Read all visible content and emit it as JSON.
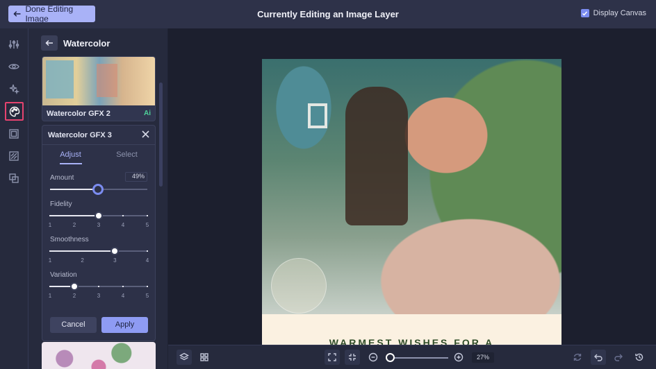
{
  "topbar": {
    "done_label": "Done Editing Image",
    "title": "Currently Editing an Image Layer",
    "display_canvas_label": "Display Canvas",
    "display_canvas_checked": true
  },
  "rail": {
    "icons": [
      "adjust-sliders-icon",
      "eye-icon",
      "sparkle-icon",
      "palette-icon",
      "frame-icon",
      "mask-icon",
      "layers-overlap-icon"
    ],
    "active": "palette-icon"
  },
  "panel": {
    "title": "Watercolor",
    "preset_top": {
      "name": "Watercolor GFX 2",
      "badge": "Ai"
    },
    "adjust": {
      "name": "Watercolor GFX 3",
      "tabs": [
        "Adjust",
        "Select"
      ],
      "active_tab": "Adjust",
      "amount": {
        "label": "Amount",
        "value_text": "49%",
        "value": 49
      },
      "fidelity": {
        "label": "Fidelity",
        "ticks": [
          "1",
          "2",
          "3",
          "4",
          "5"
        ],
        "value": 3
      },
      "smoothness": {
        "label": "Smoothness",
        "ticks": [
          "1",
          "2",
          "3",
          "4"
        ],
        "value": 3
      },
      "variation": {
        "label": "Variation",
        "ticks": [
          "1",
          "2",
          "3",
          "4",
          "5"
        ],
        "value": 2
      },
      "cancel_label": "Cancel",
      "apply_label": "Apply"
    }
  },
  "canvas": {
    "poster_text": "WARMEST WISHES FOR A"
  },
  "bottombar": {
    "zoom_value": "27%"
  },
  "colors": {
    "accent": "#a9b2f7",
    "active_outline": "#e5436f",
    "ai_badge": "#4fd39a"
  }
}
